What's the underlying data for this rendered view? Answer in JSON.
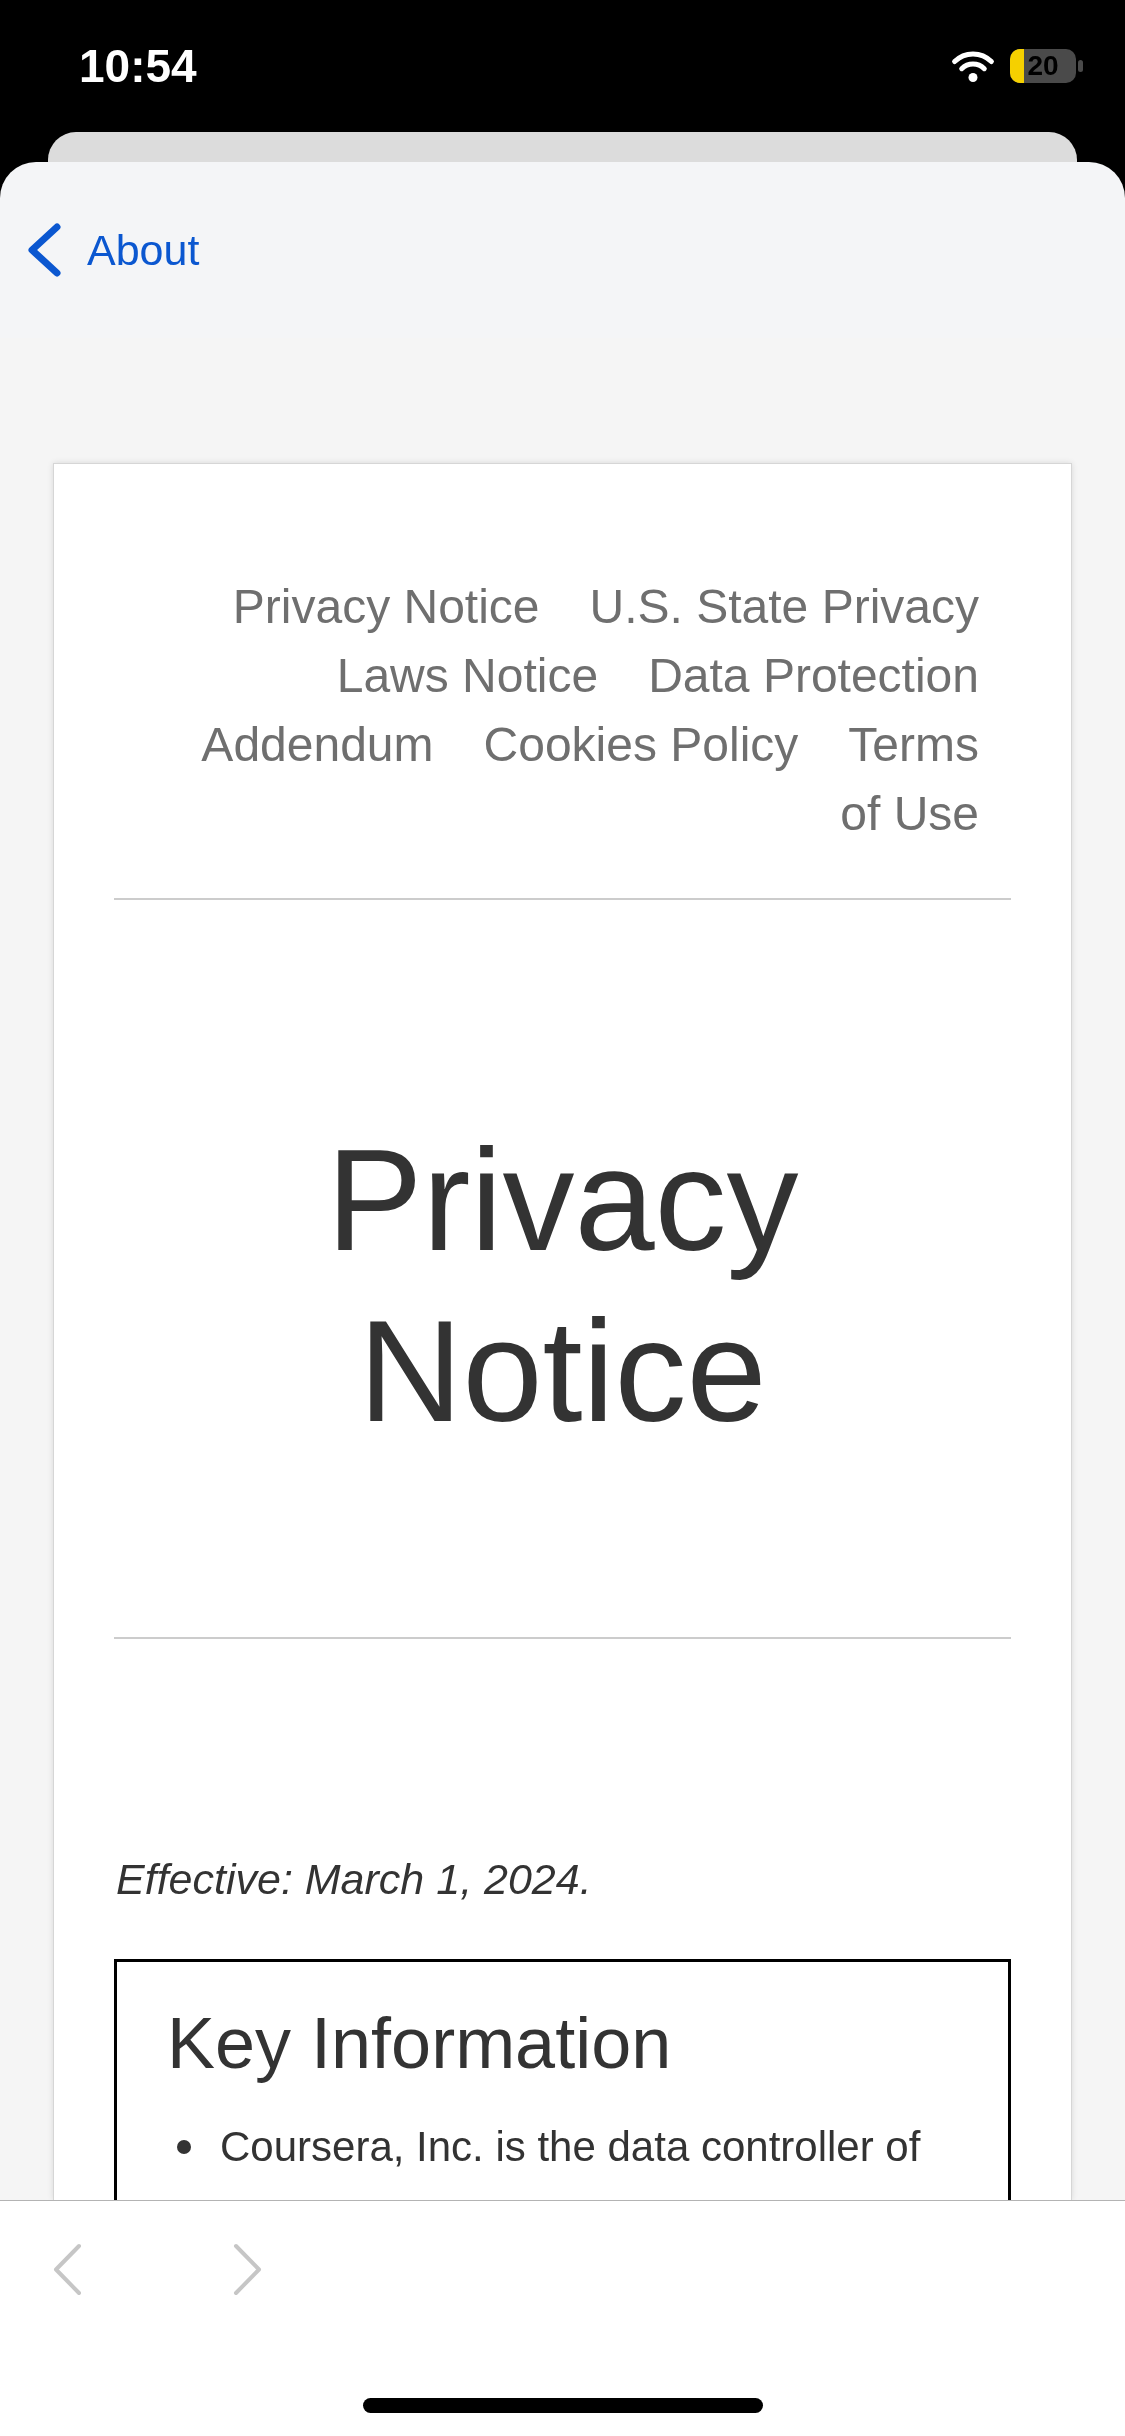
{
  "status_bar": {
    "time": "10:54",
    "battery": "20"
  },
  "nav": {
    "back_label": "About"
  },
  "document": {
    "links": [
      {
        "lines": [
          "Privacy Notice"
        ]
      },
      {
        "lines": [
          "U.S. State Privacy",
          "Laws Notice"
        ]
      },
      {
        "lines": [
          "Data Protection",
          "Addendum"
        ]
      },
      {
        "lines": [
          "Cookies Policy"
        ]
      },
      {
        "lines": [
          "Terms",
          "of Use"
        ]
      }
    ],
    "title": "Privacy Notice",
    "effective": "Effective: March 1, 2024.",
    "key_information": {
      "heading": "Key Information",
      "items": [
        "Coursera, Inc. is the data controller of"
      ]
    }
  },
  "toolbar": {
    "back": {
      "disabled": true
    },
    "forward": {
      "disabled": true
    }
  }
}
